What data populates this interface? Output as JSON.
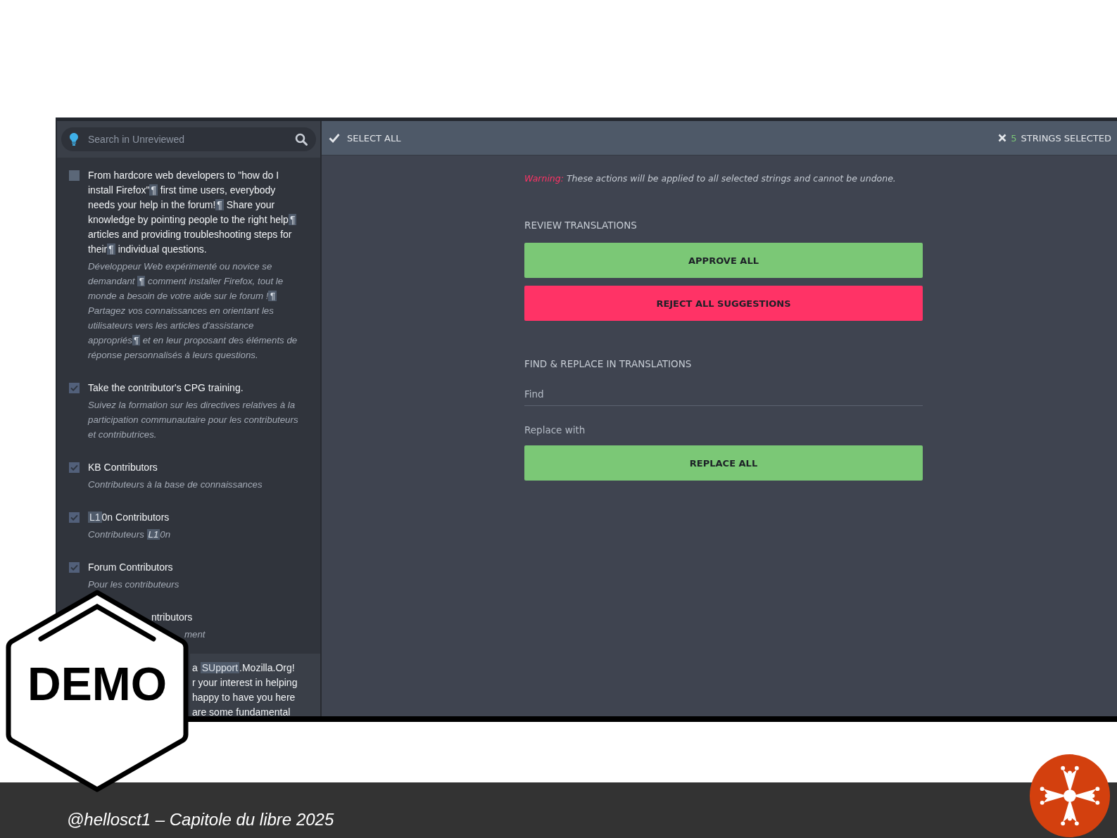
{
  "sidebar": {
    "search": {
      "placeholder": "Search in Unreviewed"
    },
    "items": [
      {
        "kind": "string",
        "checked": false,
        "selected": false,
        "title": [
          {
            "kind": "text",
            "text": "From hardcore web developers to \"how do I install Firefox\""
          },
          {
            "kind": "placeable",
            "text": "¶"
          },
          {
            "kind": "text",
            "text": " first time users, everybody needs your help in the forum!"
          },
          {
            "kind": "placeable",
            "text": "¶"
          },
          {
            "kind": "text",
            "text": " Share your knowledge by pointing people to the right help"
          },
          {
            "kind": "placeable",
            "text": "¶"
          },
          {
            "kind": "text",
            "text": " articles and providing troubleshooting steps for their"
          },
          {
            "kind": "placeable",
            "text": "¶"
          },
          {
            "kind": "text",
            "text": " individual questions."
          }
        ],
        "translation": [
          {
            "kind": "text",
            "text": "Développeur Web expérimenté ou novice se demandant "
          },
          {
            "kind": "placeable",
            "text": "¶"
          },
          {
            "kind": "text",
            "text": " comment installer Firefox, tout le monde a besoin de votre aide sur le forum !"
          },
          {
            "kind": "placeable",
            "text": "¶"
          },
          {
            "kind": "text",
            "text": " Partagez vos connaissances en orientant les utilisateurs vers les articles d'assistance appropriés"
          },
          {
            "kind": "placeable",
            "text": "¶"
          },
          {
            "kind": "text",
            "text": " et en leur proposant des éléments de réponse personnalisés à leurs questions."
          }
        ]
      },
      {
        "kind": "string",
        "checked": true,
        "selected": false,
        "title": [
          {
            "kind": "text",
            "text": "Take the contributor's CPG training."
          }
        ],
        "translation": [
          {
            "kind": "text",
            "text": "Suivez la formation sur les directives relatives à la participation communautaire pour les contributeurs et contributrices."
          }
        ]
      },
      {
        "kind": "string",
        "checked": true,
        "selected": false,
        "title": [
          {
            "kind": "text",
            "text": "KB Contributors"
          }
        ],
        "translation": [
          {
            "kind": "text",
            "text": "Contributeurs à la base de connaissances"
          }
        ]
      },
      {
        "kind": "string",
        "checked": true,
        "selected": false,
        "title": [
          {
            "kind": "placeable",
            "text": "L1"
          },
          {
            "kind": "text",
            "text": "0n Contributors"
          }
        ],
        "translation": [
          {
            "kind": "text",
            "text": "Contributeurs "
          },
          {
            "kind": "placeable",
            "text": "L1"
          },
          {
            "kind": "text",
            "text": "0n"
          }
        ]
      },
      {
        "kind": "string",
        "checked": true,
        "selected": false,
        "title": [
          {
            "kind": "text",
            "text": "Forum Contributors"
          }
        ],
        "translation": [
          {
            "kind": "text",
            "text": "Pour les contributeurs"
          }
        ]
      },
      {
        "kind": "covered",
        "selected": false,
        "title": [
          {
            "kind": "text",
            "text": "ntributors"
          }
        ],
        "translation": [
          {
            "kind": "text",
            "text": "ment"
          }
        ]
      },
      {
        "kind": "covered",
        "selected": true,
        "lines": [
          [
            {
              "kind": "text",
              "text": "a "
            },
            {
              "kind": "placeable",
              "text": "SUpport"
            },
            {
              "kind": "text",
              "text": ".Mozilla.Org!"
            }
          ],
          [
            {
              "kind": "text",
              "text": "r your interest in helping"
            }
          ],
          [
            {
              "kind": "text",
              "text": "happy to have you here"
            }
          ],
          [
            {
              "kind": "text",
              "text": "are some fundamental"
            }
          ]
        ]
      }
    ]
  },
  "toolbar": {
    "select_all": "SELECT ALL",
    "selected_count": "5",
    "selected_label": "STRINGS SELECTED"
  },
  "warning": {
    "label": "Warning:",
    "text": "These actions will be applied to all selected strings and cannot be undone."
  },
  "sections": [
    {
      "kind": "buttons",
      "heading": "REVIEW TRANSLATIONS",
      "buttons": [
        {
          "kind": "approve",
          "label": "APPROVE ALL"
        },
        {
          "kind": "reject",
          "label": "REJECT ALL SUGGESTIONS"
        }
      ]
    },
    {
      "kind": "replace",
      "heading": "FIND & REPLACE IN TRANSLATIONS",
      "find": {
        "placeholder": "Find"
      },
      "replace": {
        "placeholder": "Replace with"
      },
      "buttons": [
        {
          "kind": "approve",
          "label": "REPLACE ALL"
        }
      ]
    }
  ],
  "badge": "DEMO",
  "footer": {
    "credit": "@hellosct1 – Capitole du libre 2025"
  }
}
